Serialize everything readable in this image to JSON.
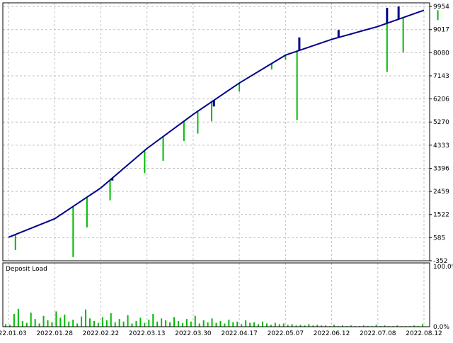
{
  "colors": {
    "background": "#ffffff",
    "frame": "#000000",
    "grid": "#c0c0c0",
    "balance_line": "#00008b",
    "equity_bars": "#00bb00",
    "balance_bars": "#00008b",
    "deposit_load": "#00bb00"
  },
  "chart_data": [
    {
      "type": "line",
      "title": "",
      "y_ticks": [
        "9954",
        "9017",
        "8080",
        "7143",
        "6206",
        "5270",
        "4333",
        "3396",
        "2459",
        "1522",
        "585",
        "-352"
      ],
      "ylim": [
        -352,
        10100
      ],
      "grid": true,
      "x_tick_labels": [
        "2022.01.03",
        "2022.01.28",
        "2022.02.22",
        "2022.03.13",
        "2022.03.30",
        "2022.04.17",
        "2022.05.07",
        "2022.06.12",
        "2022.07.08",
        "2022.08.12"
      ],
      "series": [
        {
          "role": "balance",
          "x": [
            0,
            1,
            2,
            3,
            4,
            5,
            6,
            7,
            8,
            9
          ],
          "values": [
            600,
            1350,
            2600,
            4200,
            5580,
            6850,
            7980,
            8620,
            9140,
            9800
          ]
        }
      ],
      "equity_drops": [
        {
          "x": 0.15,
          "value": 80
        },
        {
          "x": 1.4,
          "value": -200
        },
        {
          "x": 1.7,
          "value": 1000
        },
        {
          "x": 2.2,
          "value": 2100
        },
        {
          "x": 2.95,
          "value": 3200
        },
        {
          "x": 3.35,
          "value": 3700
        },
        {
          "x": 3.8,
          "value": 4500
        },
        {
          "x": 4.1,
          "value": 4800
        },
        {
          "x": 4.4,
          "value": 5300
        },
        {
          "x": 5.0,
          "value": 6500
        },
        {
          "x": 5.7,
          "value": 7400
        },
        {
          "x": 6.0,
          "value": 7800
        },
        {
          "x": 6.25,
          "value": 5350
        },
        {
          "x": 7.4,
          "value": 8800
        },
        {
          "x": 8.2,
          "value": 7300
        },
        {
          "x": 8.55,
          "value": 8100
        },
        {
          "x": 9.3,
          "value": 9400
        }
      ],
      "balance_spikes": [
        {
          "x": 2.25,
          "value": 2900
        },
        {
          "x": 4.45,
          "value": 5900
        },
        {
          "x": 6.3,
          "value": 8700
        },
        {
          "x": 7.15,
          "value": 9000
        },
        {
          "x": 8.2,
          "value": 9900
        },
        {
          "x": 8.45,
          "value": 9950
        }
      ]
    },
    {
      "type": "bar",
      "title": "Deposit Load",
      "y_ticks": [
        "100.0%",
        "0.0%"
      ],
      "ylim": [
        0,
        100
      ],
      "values": [
        4,
        3,
        20,
        28,
        9,
        6,
        22,
        12,
        5,
        17,
        10,
        7,
        24,
        14,
        19,
        8,
        11,
        5,
        16,
        27,
        13,
        9,
        6,
        15,
        10,
        21,
        7,
        12,
        8,
        18,
        5,
        9,
        14,
        6,
        11,
        20,
        8,
        13,
        10,
        7,
        15,
        9,
        6,
        12,
        8,
        17,
        5,
        10,
        7,
        13,
        6,
        9,
        5,
        11,
        7,
        8,
        4,
        10,
        6,
        7,
        4,
        8,
        5,
        3,
        6,
        4,
        5,
        3,
        4,
        2,
        3,
        2,
        4,
        2,
        3,
        2,
        2,
        1,
        3,
        1,
        2,
        1,
        2,
        1,
        1,
        2,
        1,
        1,
        3,
        1,
        2,
        1,
        1,
        2,
        1,
        1,
        1,
        2,
        1,
        4
      ]
    }
  ]
}
